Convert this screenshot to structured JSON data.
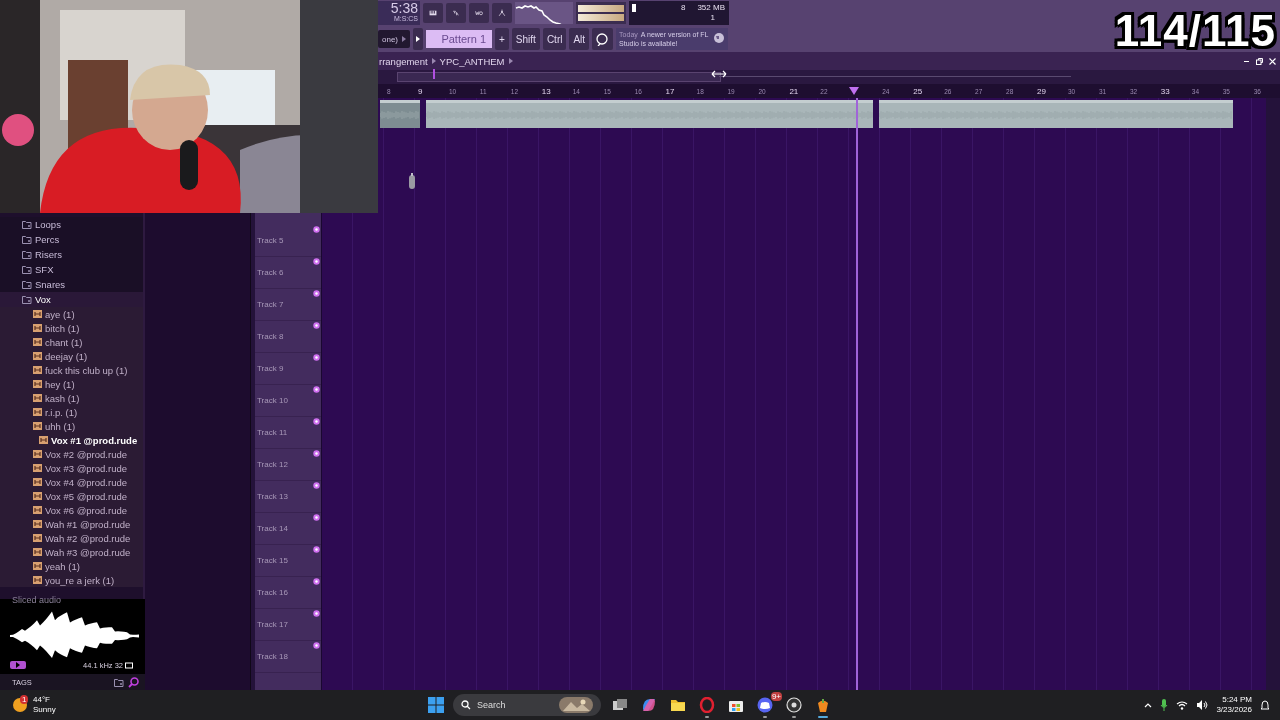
{
  "overlay": {
    "counter": "114/115"
  },
  "toolbar": {
    "time": "5:38",
    "time_format": "M:S:CS",
    "cpu": "8",
    "memory": "352 MB",
    "polyphony": "1",
    "pattern_source": "one)",
    "pattern": "Pattern 1",
    "add": "+",
    "modifiers": [
      "Shift",
      "Ctrl",
      "Alt"
    ],
    "hint": {
      "day": "Today",
      "message": "A newer version of FL Studio is available!"
    }
  },
  "browser": {
    "folders": [
      {
        "name": "Loops",
        "expanded": false
      },
      {
        "name": "Percs",
        "expanded": false
      },
      {
        "name": "Risers",
        "expanded": false
      },
      {
        "name": "SFX",
        "expanded": false
      },
      {
        "name": "Snares",
        "expanded": false
      },
      {
        "name": "Vox",
        "expanded": true,
        "children": [
          {
            "name": "aye (1)",
            "selected": false
          },
          {
            "name": "bitch (1)",
            "selected": false
          },
          {
            "name": "chant (1)",
            "selected": false
          },
          {
            "name": "deejay (1)",
            "selected": false
          },
          {
            "name": "fuck this club up (1)",
            "selected": false
          },
          {
            "name": "hey (1)",
            "selected": false
          },
          {
            "name": "kash (1)",
            "selected": false
          },
          {
            "name": "r.i.p. (1)",
            "selected": false
          },
          {
            "name": "uhh (1)",
            "selected": false
          },
          {
            "name": "Vox #1 @prod.rude",
            "selected": true
          },
          {
            "name": "Vox #2 @prod.rude",
            "selected": false
          },
          {
            "name": "Vox #3 @prod.rude",
            "selected": false
          },
          {
            "name": "Vox #4 @prod.rude",
            "selected": false
          },
          {
            "name": "Vox #5 @prod.rude",
            "selected": false
          },
          {
            "name": "Vox #6 @prod.rude",
            "selected": false
          },
          {
            "name": "Wah #1 @prod.rude",
            "selected": false
          },
          {
            "name": "Wah #2 @prod.rude",
            "selected": false
          },
          {
            "name": "Wah #3 @prod.rude",
            "selected": false
          },
          {
            "name": "yeah (1)",
            "selected": false
          },
          {
            "name": "you_re a jerk (1)",
            "selected": false
          }
        ]
      }
    ],
    "preview": {
      "title": "Sliced audio",
      "format": "44.1 kHz 32"
    },
    "tags_label": "TAGS"
  },
  "playlist": {
    "breadcrumb": [
      "rrangement",
      "YPC_ANTHEM"
    ],
    "bars": [
      {
        "label": "8",
        "major": false
      },
      {
        "label": "9",
        "major": true
      },
      {
        "label": "10",
        "major": false
      },
      {
        "label": "11",
        "major": false
      },
      {
        "label": "12",
        "major": false
      },
      {
        "label": "13",
        "major": true
      },
      {
        "label": "14",
        "major": false
      },
      {
        "label": "15",
        "major": false
      },
      {
        "label": "16",
        "major": false
      },
      {
        "label": "17",
        "major": true
      },
      {
        "label": "18",
        "major": false
      },
      {
        "label": "19",
        "major": false
      },
      {
        "label": "20",
        "major": false
      },
      {
        "label": "21",
        "major": true
      },
      {
        "label": "22",
        "major": false
      },
      {
        "playhead": true
      },
      {
        "label": "24",
        "major": false
      },
      {
        "label": "25",
        "major": true
      },
      {
        "label": "26",
        "major": false
      },
      {
        "label": "27",
        "major": false
      },
      {
        "label": "28",
        "major": false
      },
      {
        "label": "29",
        "major": true
      },
      {
        "label": "30",
        "major": false
      },
      {
        "label": "31",
        "major": false
      },
      {
        "label": "32",
        "major": false
      },
      {
        "label": "33",
        "major": true
      },
      {
        "label": "34",
        "major": false
      },
      {
        "label": "35",
        "major": false
      },
      {
        "label": "36",
        "major": false
      }
    ],
    "tracks": [
      "Track 5",
      "Track 6",
      "Track 7",
      "Track 8",
      "Track 9",
      "Track 10",
      "Track 11",
      "Track 12",
      "Track 13",
      "Track 14",
      "Track 15",
      "Track 16",
      "Track 17",
      "Track 18"
    ]
  },
  "taskbar": {
    "weather": {
      "temperature": "44°F",
      "condition": "Sunny",
      "badge": "1"
    },
    "search": "Search",
    "apps": [
      {
        "kind": "taskview",
        "running": false
      },
      {
        "kind": "copilot",
        "running": false
      },
      {
        "kind": "files",
        "running": false
      },
      {
        "kind": "opera",
        "running": true
      },
      {
        "kind": "store",
        "running": false
      },
      {
        "kind": "discord",
        "running": true,
        "badge": "9+"
      },
      {
        "kind": "obs",
        "running": true
      },
      {
        "kind": "fl",
        "running": true
      }
    ],
    "time": "5:24 PM",
    "date": "3/23/2026"
  }
}
